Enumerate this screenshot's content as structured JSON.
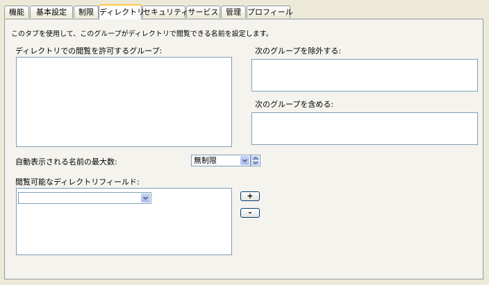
{
  "tabs": [
    {
      "label": "機能"
    },
    {
      "label": "基本設定"
    },
    {
      "label": "制限"
    },
    {
      "label": "ディレクトリ"
    },
    {
      "label": "セキュリティ"
    },
    {
      "label": "サービス"
    },
    {
      "label": "管理"
    },
    {
      "label": "プロフィール"
    }
  ],
  "active_tab": "ディレクトリ",
  "description": "このタブを使用して、このグループがディレクトリで閲覧できる名前を設定します。",
  "allow_groups": {
    "label": "ディレクトリでの閲覧を許可するグループ:"
  },
  "exclude_groups": {
    "label": "次のグループを除外する:"
  },
  "include_groups": {
    "label": "次のグループを含める:"
  },
  "max_names": {
    "label": "自動表示される名前の最大数:",
    "value": "無制限"
  },
  "fields": {
    "label": "閲覧可能なディレクトリフィールド:",
    "value": ""
  },
  "buttons": {
    "add": "+",
    "remove": "-"
  },
  "colors": {
    "panel_bg": "#f4f3ee",
    "tab_active_top": "#ffc83c",
    "field_border": "#7f9db9"
  }
}
